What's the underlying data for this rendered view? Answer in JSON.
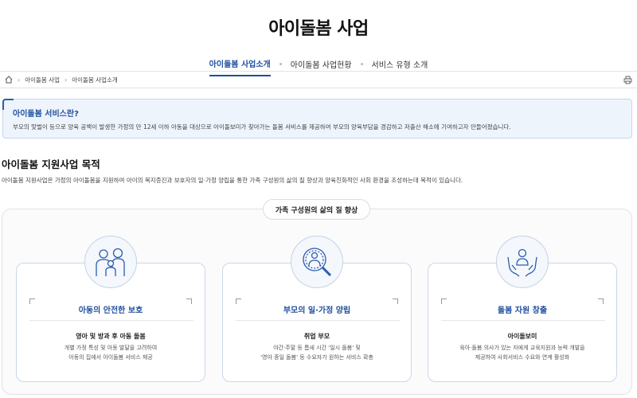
{
  "page": {
    "title": "아이돌봄 사업"
  },
  "tabs": [
    {
      "label": "아이돌봄 사업소개",
      "active": true
    },
    {
      "label": "아이돌봄 사업현황",
      "active": false
    },
    {
      "label": "서비스 유형 소개",
      "active": false
    }
  ],
  "breadcrumb": {
    "home_icon": "home-icon",
    "items": [
      "아이돌봄 사업",
      "아이돌봄 사업소개"
    ],
    "print_icon": "print-icon"
  },
  "info": {
    "title": "아이돌봄 서비스란?",
    "text": "부모의 맞벌이 등으로 양육 공백이 발생한 가정의 만 12세 이하 아동을 대상으로 아이돌보미가 찾아가는 돌봄 서비스를 제공하여 부모의 양육부담을 경감하고 저출산 해소에 기여하고자 만들어졌습니다."
  },
  "section": {
    "title": "아이돌봄 지원사업 목적",
    "desc": "아이돌봄 지원사업은 가정의 아이돌봄을 지원하여 아이의 복지증진과 보호자의 일·가정 양립을 통한 가족 구성원의 삶의 질 향상과 양육친화적인 사회 환경을 조성하는데 목적이 있습니다."
  },
  "goal": {
    "label": "가족 구성원의 삶의 질 향상"
  },
  "cards": [
    {
      "icon": "family-icon",
      "title": "아동의 안전한 보호",
      "subtitle": "영아 및 방과 후 아동 돌봄",
      "lines": [
        "개별 가정 특성 및 아동 발달을 고려하여",
        "아동의 집에서 아이돌봄 서비스 제공"
      ]
    },
    {
      "icon": "magnifier-person-icon",
      "title": "부모의 일·가정 양립",
      "subtitle": "취업 부모",
      "lines": [
        "야간·주말 등 틈새 시간 '일시 돌봄' 및",
        "'영아 종일 돌봄' 등 수요자가 원하는 서비스 확충"
      ]
    },
    {
      "icon": "hands-person-icon",
      "title": "돌봄 자원 창출",
      "subtitle": "아이돌보미",
      "lines": [
        "육아·돌봄 의사가 있는 자에게 교육지원과 능력 개발을",
        "제공하여 사회서비스 수요와 연계 활성화"
      ]
    }
  ],
  "colors": {
    "accent": "#1f4f9e",
    "info_bg": "#eef4fb",
    "card_border": "#cad7e8"
  }
}
